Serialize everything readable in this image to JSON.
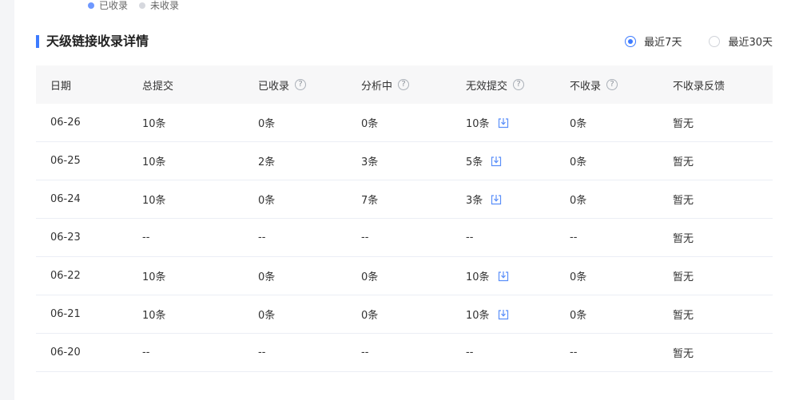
{
  "legend": [
    {
      "label": "已收录",
      "color": "#6e98ff"
    },
    {
      "label": "未收录",
      "color": "#d6d8de"
    }
  ],
  "section": {
    "title": "天级链接收录详情",
    "range_options": [
      {
        "label": "最近7天",
        "selected": true
      },
      {
        "label": "最近30天",
        "selected": false
      }
    ]
  },
  "table": {
    "headers": [
      {
        "label": "日期",
        "help": false
      },
      {
        "label": "总提交",
        "help": false
      },
      {
        "label": "已收录",
        "help": true
      },
      {
        "label": "分析中",
        "help": true
      },
      {
        "label": "无效提交",
        "help": true
      },
      {
        "label": "不收录",
        "help": true
      },
      {
        "label": "不收录反馈",
        "help": false
      }
    ],
    "rows": [
      {
        "date": "06-26",
        "total": "10条",
        "indexed": "0条",
        "analyzing": "0条",
        "invalid": "10条",
        "invalid_download": true,
        "not_indexed": "0条",
        "feedback": "暂无"
      },
      {
        "date": "06-25",
        "total": "10条",
        "indexed": "2条",
        "analyzing": "3条",
        "invalid": "5条",
        "invalid_download": true,
        "not_indexed": "0条",
        "feedback": "暂无"
      },
      {
        "date": "06-24",
        "total": "10条",
        "indexed": "0条",
        "analyzing": "7条",
        "invalid": "3条",
        "invalid_download": true,
        "not_indexed": "0条",
        "feedback": "暂无"
      },
      {
        "date": "06-23",
        "total": "--",
        "indexed": "--",
        "analyzing": "--",
        "invalid": "--",
        "invalid_download": false,
        "not_indexed": "--",
        "feedback": "暂无"
      },
      {
        "date": "06-22",
        "total": "10条",
        "indexed": "0条",
        "analyzing": "0条",
        "invalid": "10条",
        "invalid_download": true,
        "not_indexed": "0条",
        "feedback": "暂无"
      },
      {
        "date": "06-21",
        "total": "10条",
        "indexed": "0条",
        "analyzing": "0条",
        "invalid": "10条",
        "invalid_download": true,
        "not_indexed": "0条",
        "feedback": "暂无"
      },
      {
        "date": "06-20",
        "total": "--",
        "indexed": "--",
        "analyzing": "--",
        "invalid": "--",
        "invalid_download": false,
        "not_indexed": "--",
        "feedback": "暂无"
      }
    ]
  },
  "colors": {
    "accent": "#3d7bff",
    "icon": "#5b8ff9"
  }
}
